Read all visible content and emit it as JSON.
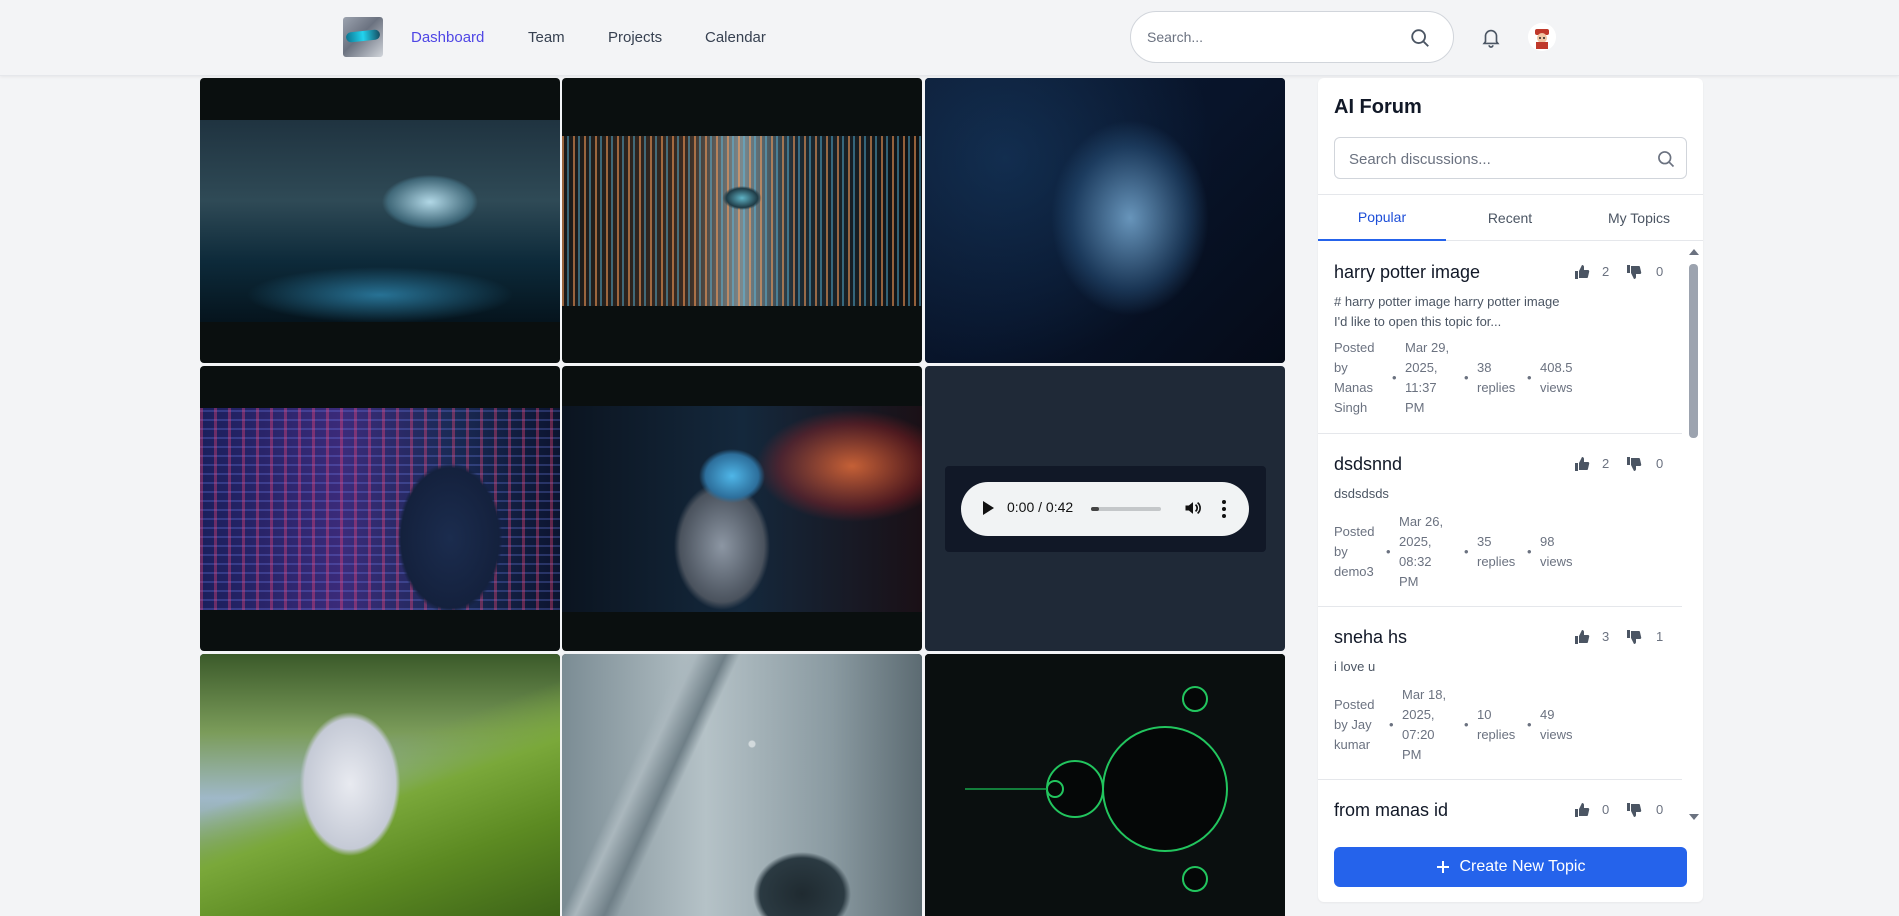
{
  "nav": {
    "items": [
      "Dashboard",
      "Team",
      "Projects",
      "Calendar"
    ],
    "active": "Dashboard",
    "search_placeholder": "Search..."
  },
  "icons": {
    "search": "search-icon",
    "bell": "bell-icon",
    "avatar": "avatar",
    "thumb_up": "thumbs-up-icon",
    "thumb_down": "thumbs-down-icon",
    "plus": "plus-icon"
  },
  "colors": {
    "accent": "#4f46e5",
    "primary_button": "#2563eb",
    "active_tab": "#1d4ed8"
  },
  "media": {
    "audio": {
      "time": "0:00 / 0:42",
      "progress": 0.0
    }
  },
  "forum": {
    "title": "AI Forum",
    "search_placeholder": "Search discussions...",
    "tabs": [
      "Popular",
      "Recent",
      "My Topics"
    ],
    "active_tab": "Popular",
    "topics": [
      {
        "title": "harry potter image",
        "excerpt": "# harry potter image harry potter image I'd like to open this topic for...",
        "likes": "2",
        "dislikes": "0",
        "posted_by": [
          "Posted",
          "by",
          "Manas",
          "Singh"
        ],
        "date": [
          "Mar 29,",
          "2025,",
          "11:37",
          "PM"
        ],
        "replies": [
          "38",
          "replies"
        ],
        "views": [
          "408.5",
          "views"
        ]
      },
      {
        "title": "dsdsnnd",
        "excerpt": "dsdsdsds",
        "likes": "2",
        "dislikes": "0",
        "posted_by": [
          "Posted",
          "by",
          "demo3"
        ],
        "date": [
          "Mar 26,",
          "2025,",
          "08:32",
          "PM"
        ],
        "replies": [
          "35",
          "replies"
        ],
        "views": [
          "98",
          "views"
        ]
      },
      {
        "title": "sneha hs",
        "excerpt": "i love u",
        "likes": "3",
        "dislikes": "1",
        "posted_by": [
          "Posted",
          "by Jay",
          "kumar"
        ],
        "date": [
          "Mar 18,",
          "2025,",
          "07:20",
          "PM"
        ],
        "replies": [
          "10",
          "replies"
        ],
        "views": [
          "49",
          "views"
        ]
      },
      {
        "title": "from manas id",
        "likes": "0",
        "dislikes": "0"
      }
    ],
    "create_label": "Create New Topic"
  }
}
